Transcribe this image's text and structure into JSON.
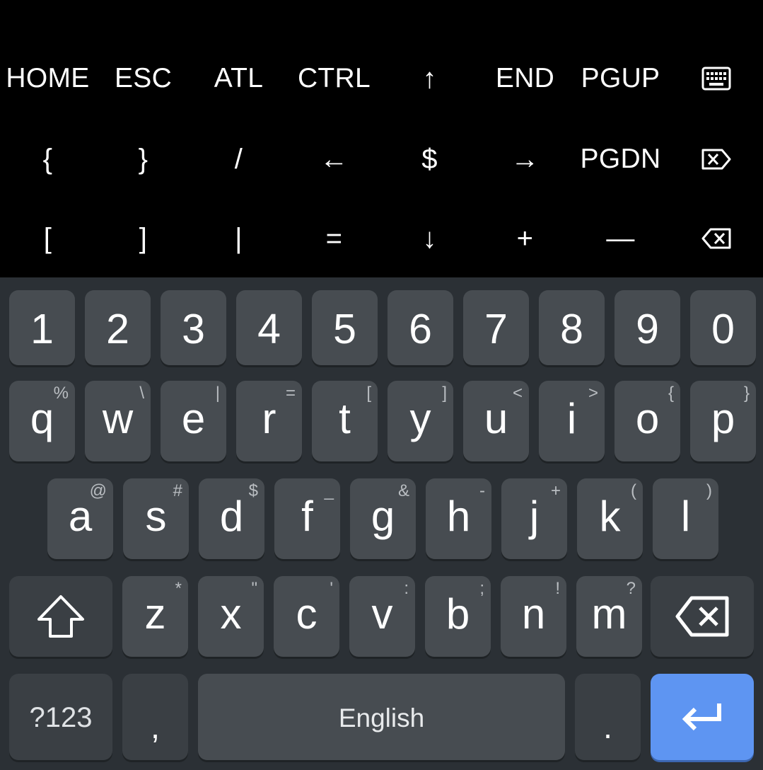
{
  "extra_keys": {
    "row1": [
      "HOME",
      "ESC",
      "ATL",
      "CTRL",
      "↑",
      "END",
      "PGUP"
    ],
    "row2": [
      "{",
      "}",
      "/",
      "←",
      "$",
      "→",
      "PGDN"
    ],
    "row3": [
      "[",
      "]",
      "|",
      "=",
      "↓",
      "+",
      "—"
    ],
    "icons": {
      "row1_last": "keyboard-icon",
      "row2_last": "delete-forward-icon",
      "row3_last": "backspace-icon"
    }
  },
  "keyboard": {
    "number_row": [
      "1",
      "2",
      "3",
      "4",
      "5",
      "6",
      "7",
      "8",
      "9",
      "0"
    ],
    "row_q": [
      {
        "key": "q",
        "hint": "%"
      },
      {
        "key": "w",
        "hint": "\\"
      },
      {
        "key": "e",
        "hint": "|"
      },
      {
        "key": "r",
        "hint": "="
      },
      {
        "key": "t",
        "hint": "["
      },
      {
        "key": "y",
        "hint": "]"
      },
      {
        "key": "u",
        "hint": "<"
      },
      {
        "key": "i",
        "hint": ">"
      },
      {
        "key": "o",
        "hint": "{"
      },
      {
        "key": "p",
        "hint": "}"
      }
    ],
    "row_a": [
      {
        "key": "a",
        "hint": "@"
      },
      {
        "key": "s",
        "hint": "#"
      },
      {
        "key": "d",
        "hint": "$"
      },
      {
        "key": "f",
        "hint": "_"
      },
      {
        "key": "g",
        "hint": "&"
      },
      {
        "key": "h",
        "hint": "-"
      },
      {
        "key": "j",
        "hint": "+"
      },
      {
        "key": "k",
        "hint": "("
      },
      {
        "key": "l",
        "hint": ")"
      }
    ],
    "row_z": [
      {
        "key": "z",
        "hint": "*"
      },
      {
        "key": "x",
        "hint": "\""
      },
      {
        "key": "c",
        "hint": "'"
      },
      {
        "key": "v",
        "hint": ":"
      },
      {
        "key": "b",
        "hint": ";"
      },
      {
        "key": "n",
        "hint": "!"
      },
      {
        "key": "m",
        "hint": "?"
      }
    ],
    "symbols_key": "?123",
    "comma_key": ",",
    "space_label": "English",
    "period_key": ".",
    "icons": {
      "shift": "shift-icon",
      "backspace": "backspace-icon",
      "enter": "enter-icon"
    },
    "colors": {
      "background": "#2b3035",
      "key": "#474c51",
      "enter": "#5e95f2"
    }
  }
}
